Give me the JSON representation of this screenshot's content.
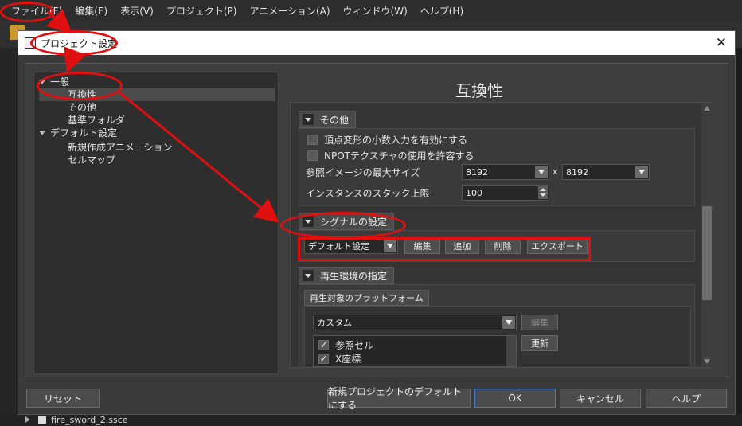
{
  "app_menu": [
    "ファイル(F)",
    "編集(E)",
    "表示(V)",
    "プロジェクト(P)",
    "アニメーション(A)",
    "ウィンドウ(W)",
    "ヘルプ(H)"
  ],
  "background": {
    "file_item": "fire_sword_2.ssce"
  },
  "dialog": {
    "title": "プロジェクト設定",
    "close_glyph": "✕",
    "tree": {
      "general": "一般",
      "compat": "互換性",
      "other": "その他",
      "base_folder": "基準フォルダ",
      "default_settings": "デフォルト設定",
      "new_animation": "新規作成アニメーション",
      "cellmap": "セルマップ"
    },
    "page_title": "互換性",
    "sections": {
      "other": {
        "title": "その他",
        "vertex_decimal": "頂点変形の小数入力を有効にする",
        "npot_texture": "NPOTテクスチャの使用を許容する",
        "ref_image_max_label": "参照イメージの最大サイズ",
        "ref_image_w": "8192",
        "times": "x",
        "ref_image_h": "8192",
        "instance_stack_label": "インスタンスのスタック上限",
        "instance_stack_value": "100"
      },
      "signal": {
        "title": "シグナルの設定",
        "preset": "デフォルト設定",
        "edit": "編集",
        "add": "追加",
        "delete": "削除",
        "export": "エクスポート"
      },
      "playback": {
        "title": "再生環境の指定",
        "platform_tab": "再生対象のプラットフォーム",
        "platform": "カスタム",
        "edit": "編集",
        "update": "更新",
        "items": [
          {
            "label": "参照セル",
            "checked": true
          },
          {
            "label": "X座標",
            "checked": true
          }
        ]
      }
    },
    "footer": {
      "reset": "リセット",
      "make_default": "新規プロジェクトのデフォルトにする",
      "ok": "OK",
      "cancel": "キャンセル",
      "help": "ヘルプ"
    }
  },
  "annotation_color": "#e01010"
}
